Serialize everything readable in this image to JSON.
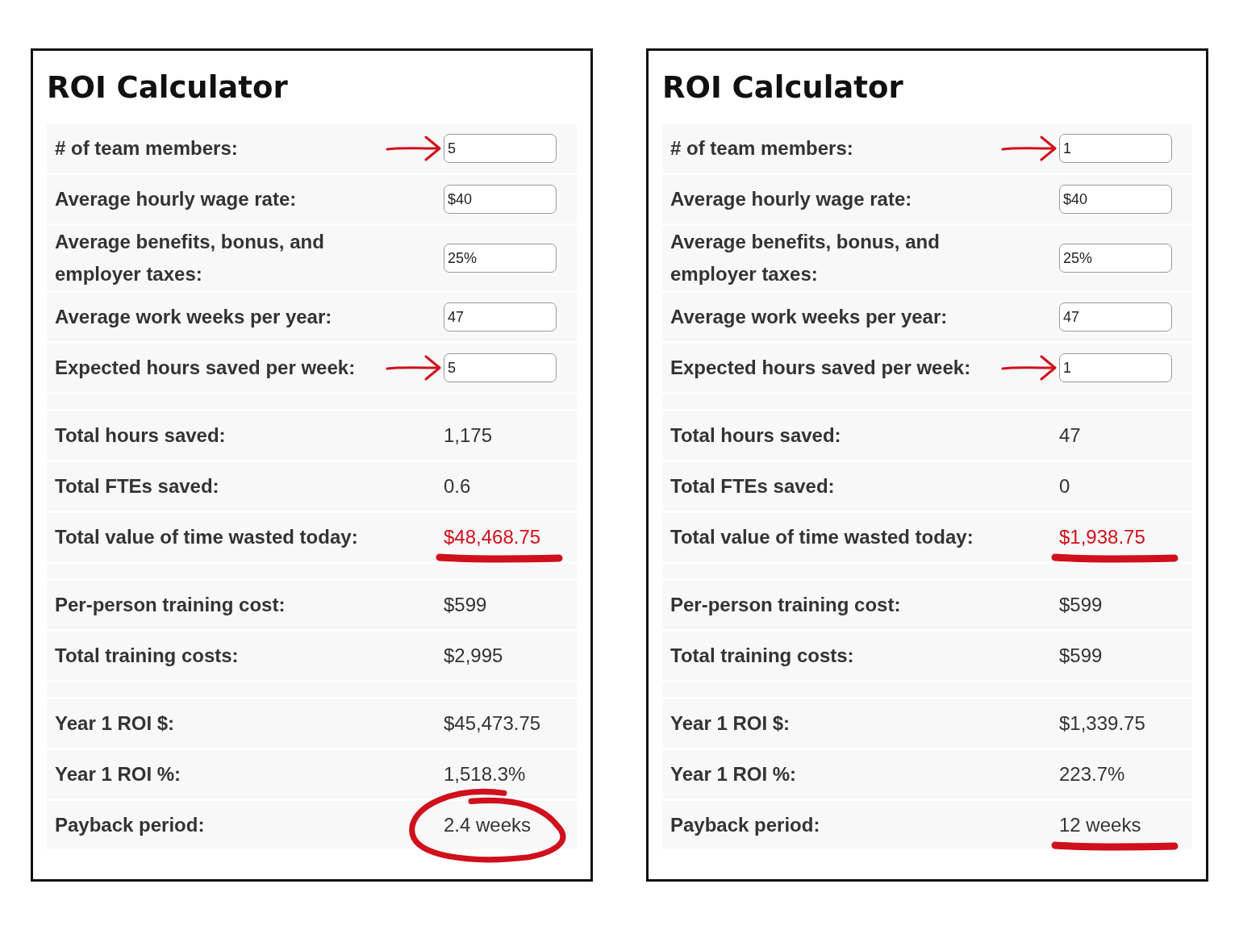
{
  "panels": [
    {
      "title": "ROI Calculator",
      "inputs": [
        {
          "label": "# of team members:",
          "value": "5",
          "arrow": true
        },
        {
          "label": "Average hourly wage rate:",
          "value": "$40",
          "arrow": false
        },
        {
          "label": "Average benefits, bonus, and employer taxes:",
          "value": "25%",
          "arrow": false
        },
        {
          "label": "Average work weeks per year:",
          "value": "47",
          "arrow": false
        },
        {
          "label": "Expected hours saved per week:",
          "value": "5",
          "arrow": true
        }
      ],
      "groups": [
        [
          {
            "label": "Total hours saved:",
            "value": "1,175",
            "highlighted": false,
            "kind": "plain"
          },
          {
            "label": "Total FTEs saved:",
            "value": "0.6",
            "highlighted": false,
            "kind": "plain"
          },
          {
            "label": "Total value of time wasted today:",
            "value": "$48,468.75",
            "highlighted": true,
            "kind": "underlined"
          }
        ],
        [
          {
            "label": "Per-person training cost:",
            "value": "$599",
            "highlighted": false,
            "kind": "plain"
          },
          {
            "label": "Total training costs:",
            "value": "$2,995",
            "highlighted": false,
            "kind": "plain"
          }
        ],
        [
          {
            "label": "Year 1 ROI $:",
            "value": "$45,473.75",
            "highlighted": false,
            "kind": "plain"
          },
          {
            "label": "Year 1 ROI %:",
            "value": "1,518.3%",
            "highlighted": false,
            "kind": "plain"
          },
          {
            "label": "Payback period:",
            "value": "2.4 weeks",
            "highlighted": false,
            "kind": "circled"
          }
        ]
      ]
    },
    {
      "title": "ROI Calculator",
      "inputs": [
        {
          "label": "# of team members:",
          "value": "1",
          "arrow": true
        },
        {
          "label": "Average hourly wage rate:",
          "value": "$40",
          "arrow": false
        },
        {
          "label": "Average benefits, bonus, and employer taxes:",
          "value": "25%",
          "arrow": false
        },
        {
          "label": "Average work weeks per year:",
          "value": "47",
          "arrow": false
        },
        {
          "label": "Expected hours saved per week:",
          "value": "1",
          "arrow": true
        }
      ],
      "groups": [
        [
          {
            "label": "Total hours saved:",
            "value": "47",
            "highlighted": false,
            "kind": "plain"
          },
          {
            "label": "Total FTEs saved:",
            "value": "0",
            "highlighted": false,
            "kind": "plain"
          },
          {
            "label": "Total value of time wasted today:",
            "value": "$1,938.75",
            "highlighted": true,
            "kind": "underlined"
          }
        ],
        [
          {
            "label": "Per-person training cost:",
            "value": "$599",
            "highlighted": false,
            "kind": "plain"
          },
          {
            "label": "Total training costs:",
            "value": "$599",
            "highlighted": false,
            "kind": "plain"
          }
        ],
        [
          {
            "label": "Year 1 ROI $:",
            "value": "$1,339.75",
            "highlighted": false,
            "kind": "plain"
          },
          {
            "label": "Year 1 ROI %:",
            "value": "223.7%",
            "highlighted": false,
            "kind": "plain"
          },
          {
            "label": "Payback period:",
            "value": "12 weeks",
            "highlighted": false,
            "kind": "underlined"
          }
        ]
      ]
    }
  ]
}
